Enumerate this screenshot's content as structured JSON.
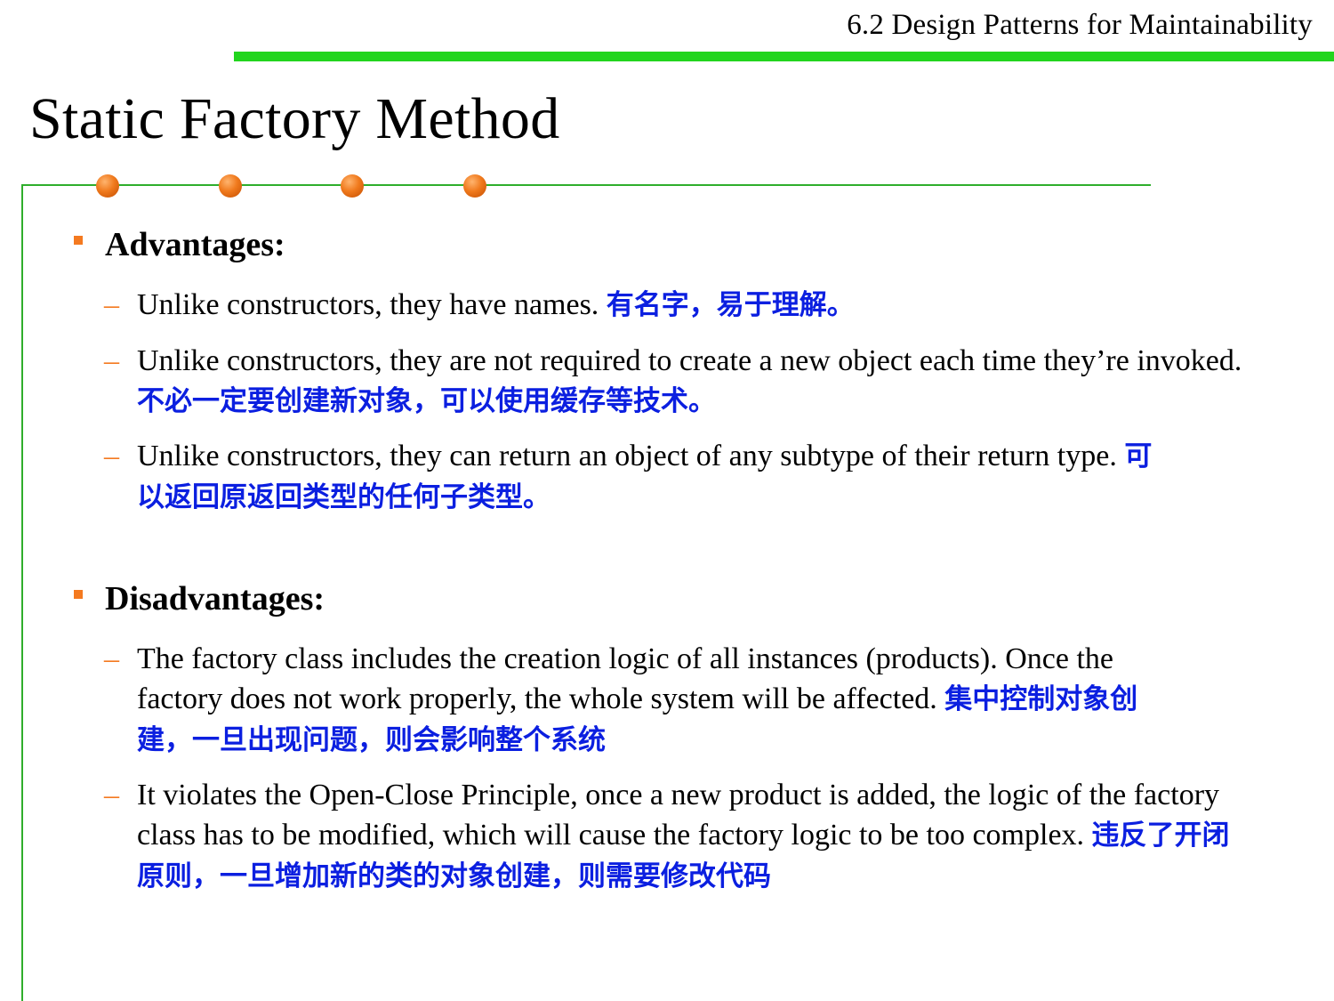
{
  "header": {
    "chapter": "6.2 Design Patterns for Maintainability"
  },
  "title": "Static Factory Method",
  "colors": {
    "accent_green": "#22d51e",
    "bullet_orange": "#f47a20",
    "chinese_blue": "#0b1fe0"
  },
  "advantages": {
    "heading": "Advantages:",
    "items": [
      {
        "en": "Unlike constructors, they have names.",
        "cn": "有名字，易于理解。"
      },
      {
        "en": "Unlike constructors, they are not required to create a new object each time they’re invoked. ",
        "cn": "不必一定要创建新对象，可以使用缓存等技术。"
      },
      {
        "en": "Unlike constructors, they can return an object of any subtype of their return type.",
        "cn": "可以返回原返回类型的任何子类型。"
      }
    ]
  },
  "disadvantages": {
    "heading": "Disadvantages:",
    "items": [
      {
        "en": "The factory class includes the creation logic of all instances (products). Once the factory does not work properly, the whole system will be affected.",
        "cn": "集中控制对象创建，一旦出现问题，则会影响整个系统"
      },
      {
        "en": "It violates the Open-Close Principle, once a new product is added, the logic of the factory class has to be modified, which will cause the factory logic to be too complex.",
        "cn": "违反了开闭原则，一旦增加新的类的对象创建，则需要修改代码"
      }
    ]
  }
}
